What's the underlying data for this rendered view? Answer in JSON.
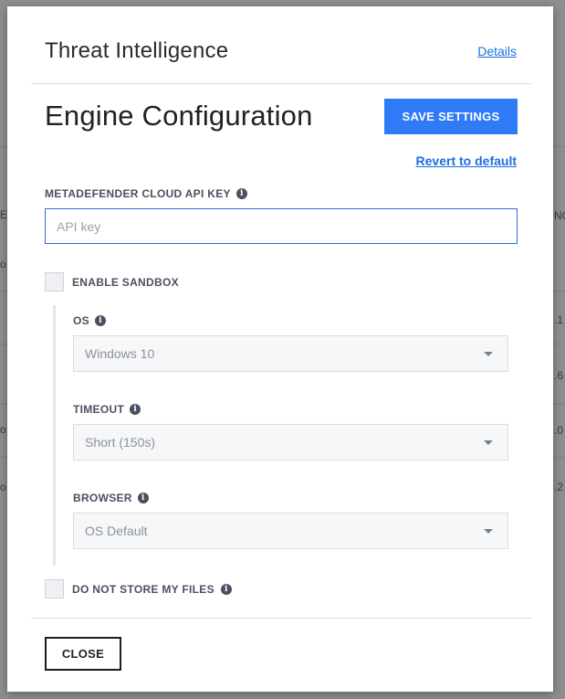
{
  "background": {
    "left_edge_fragments": [
      "E",
      "o",
      "o",
      "o"
    ],
    "right_edge_fragments": [
      "NG",
      ".1",
      ".6",
      ".0",
      ".2"
    ]
  },
  "modal": {
    "title": "Threat Intelligence",
    "details_link": "Details"
  },
  "engine": {
    "title": "Engine Configuration",
    "save_button": "SAVE SETTINGS",
    "revert_link": "Revert to default"
  },
  "api_key": {
    "label": "METADEFENDER CLOUD API KEY",
    "placeholder": "API key",
    "value": ""
  },
  "sandbox": {
    "enable_label": "ENABLE SANDBOX",
    "enabled": false,
    "os": {
      "label": "OS",
      "value": "Windows 10"
    },
    "timeout": {
      "label": "TIMEOUT",
      "value": "Short (150s)"
    },
    "browser": {
      "label": "BROWSER",
      "value": "OS Default"
    }
  },
  "do_not_store": {
    "label": "DO NOT STORE MY FILES",
    "checked": false
  },
  "footer": {
    "close_button": "CLOSE"
  },
  "colors": {
    "accent": "#2f7bf6",
    "link": "#1d6fe0",
    "input_focus_border": "#2b6fd6",
    "overlay": "#8f8f8f"
  },
  "icons": {
    "info": "info-icon",
    "dropdown": "chevron-down-icon"
  }
}
